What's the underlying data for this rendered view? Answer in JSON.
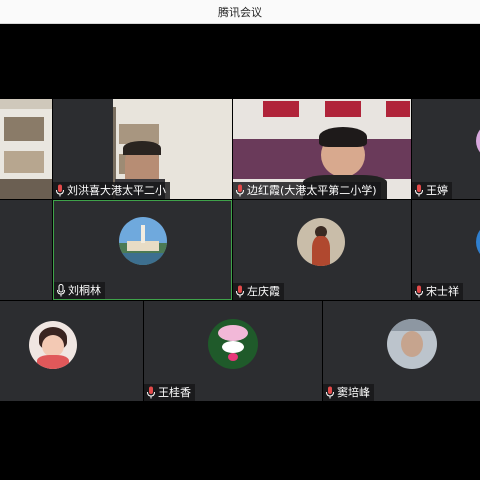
{
  "window": {
    "title": "腾讯会议"
  },
  "participants": [
    {
      "name": "刘洪喜大港太平二小"
    },
    {
      "name": "边红霞(大港太平第二小学)"
    },
    {
      "name": "王婷"
    },
    {
      "name": "刘桐林"
    },
    {
      "name": "左庆霞"
    },
    {
      "name": "宋士祥"
    },
    {
      "name": "王桂香"
    },
    {
      "name": "窦培峰"
    }
  ],
  "icons": {
    "mic": "microphone-icon",
    "mic_color": "#e34a4a"
  },
  "colors": {
    "active_border": "#3fa24a",
    "tile_bg": "#2c2d30"
  }
}
